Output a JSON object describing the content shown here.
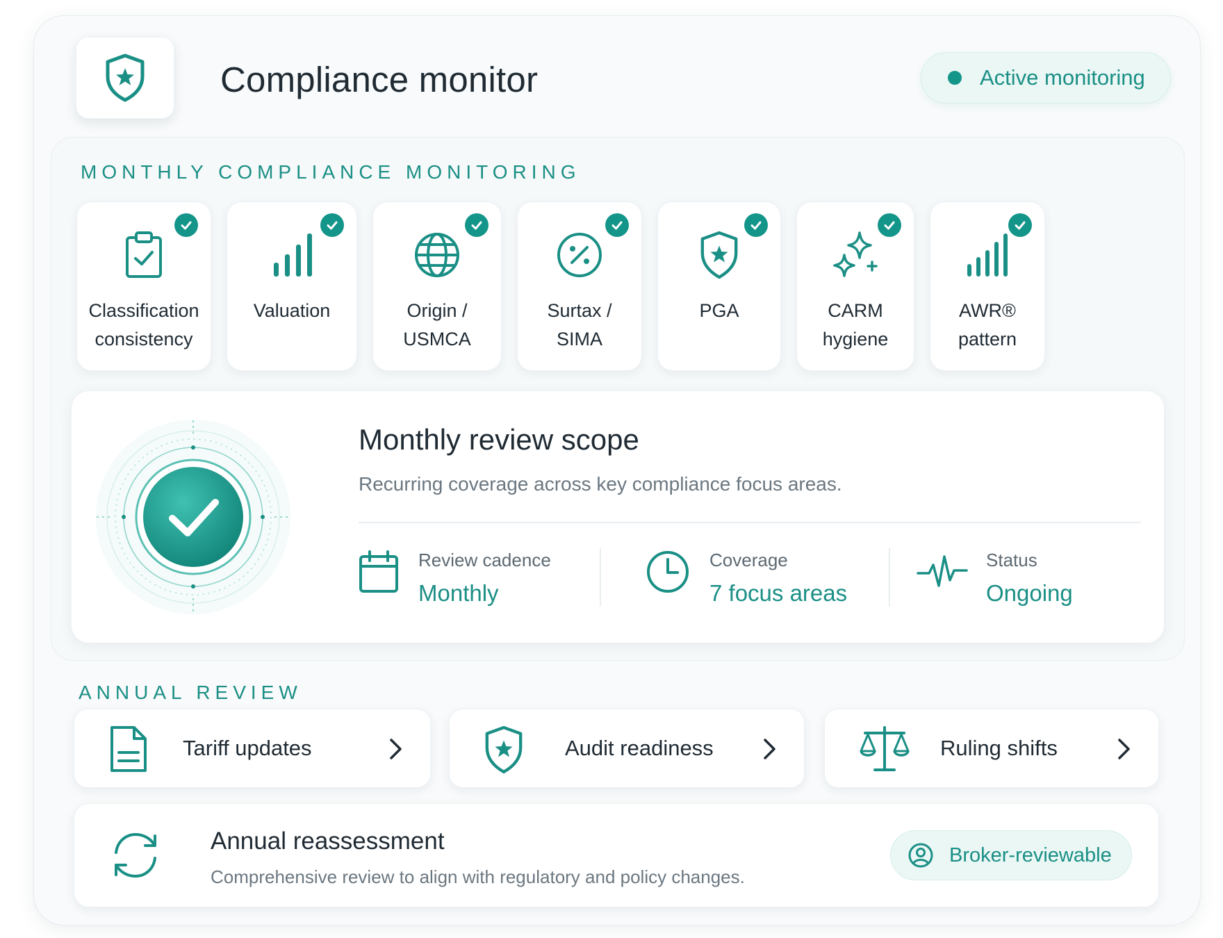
{
  "header": {
    "title": "Compliance monitor",
    "status_label": "Active monitoring"
  },
  "monthly": {
    "section_label": "MONTHLY COMPLIANCE MONITORING",
    "cards": [
      {
        "label": "Classification\nconsistency",
        "icon": "clipboard-check-icon",
        "checked": true
      },
      {
        "label": "Valuation",
        "icon": "bar-chart-icon",
        "checked": true
      },
      {
        "label": "Origin /\nUSMCA",
        "icon": "globe-icon",
        "checked": true
      },
      {
        "label": "Surtax /\nSIMA",
        "icon": "percent-icon",
        "checked": true
      },
      {
        "label": "PGA",
        "icon": "shield-star-icon",
        "checked": true
      },
      {
        "label": "CARM\nhygiene",
        "icon": "sparkles-icon",
        "checked": true
      },
      {
        "label": "AWR®\npattern",
        "icon": "bars-icon",
        "checked": true
      }
    ],
    "scope": {
      "title": "Monthly review scope",
      "subtitle": "Recurring coverage across key compliance focus areas.",
      "stats": [
        {
          "label": "Review cadence",
          "value": "Monthly",
          "icon": "calendar-icon"
        },
        {
          "label": "Coverage",
          "value": "7 focus areas",
          "icon": "clock-icon"
        },
        {
          "label": "Status",
          "value": "Ongoing",
          "icon": "pulse-icon"
        }
      ]
    }
  },
  "annual": {
    "section_label": "ANNUAL REVIEW",
    "items": [
      {
        "label": "Tariff updates",
        "icon": "document-icon"
      },
      {
        "label": "Audit readiness",
        "icon": "shield-star-icon"
      },
      {
        "label": "Ruling shifts",
        "icon": "scales-icon"
      }
    ],
    "reassessment": {
      "title": "Annual reassessment",
      "subtitle": "Comprehensive review to align with regulatory and policy changes.",
      "badge": "Broker-reviewable",
      "icon": "refresh-icon",
      "badge_icon": "user-circle-icon"
    }
  },
  "colors": {
    "accent": "#1a8f85",
    "accent_dark": "#14958a",
    "pill_bg": "#eaf7f5",
    "text": "#1f2a33",
    "muted": "#6b7780"
  }
}
